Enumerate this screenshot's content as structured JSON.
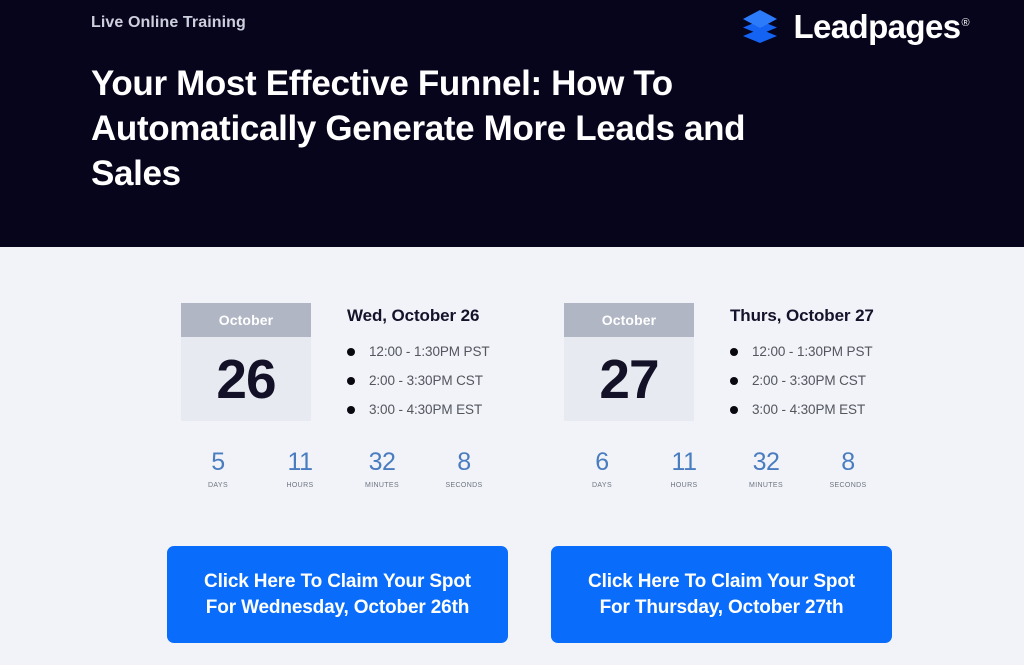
{
  "theme": {
    "hero_bg": "#07051c",
    "page_bg": "#f1f3f8",
    "accent_blue": "#0a6cfb",
    "countdown_blue": "#4a7cc0",
    "calendar_header_bg": "#b1b6c5",
    "calendar_body_bg": "#e8eaf1",
    "headline_color": "#ffffff"
  },
  "hero": {
    "eyebrow": "Live Online Training",
    "title": "Your Most Effective Funnel: How To Automatically Generate More Leads and Sales",
    "brand": {
      "name": "Leadpages",
      "trademark": "®",
      "logo_icon": "stacked-layers-icon"
    }
  },
  "sessions": [
    {
      "calendar": {
        "month": "October",
        "day": "26"
      },
      "date_heading": "Wed, October 26",
      "times": [
        "12:00 - 1:30PM PST",
        "2:00 - 3:30PM CST",
        "3:00 - 4:30PM EST"
      ],
      "countdown": [
        {
          "value": "5",
          "label": "DAYS"
        },
        {
          "value": "11",
          "label": "HOURS"
        },
        {
          "value": "32",
          "label": "MINUTES"
        },
        {
          "value": "8",
          "label": "SECONDS"
        }
      ],
      "cta": {
        "line1": "Click Here To Claim Your Spot",
        "line2": "For Wednesday, October 26th"
      }
    },
    {
      "calendar": {
        "month": "October",
        "day": "27"
      },
      "date_heading": "Thurs, October 27",
      "times": [
        "12:00 - 1:30PM PST",
        "2:00 - 3:30PM CST",
        "3:00 - 4:30PM EST"
      ],
      "countdown": [
        {
          "value": "6",
          "label": "DAYS"
        },
        {
          "value": "11",
          "label": "HOURS"
        },
        {
          "value": "32",
          "label": "MINUTES"
        },
        {
          "value": "8",
          "label": "SECONDS"
        }
      ],
      "cta": {
        "line1": "Click Here To Claim Your Spot",
        "line2": "For Thursday, October 27th"
      }
    }
  ]
}
